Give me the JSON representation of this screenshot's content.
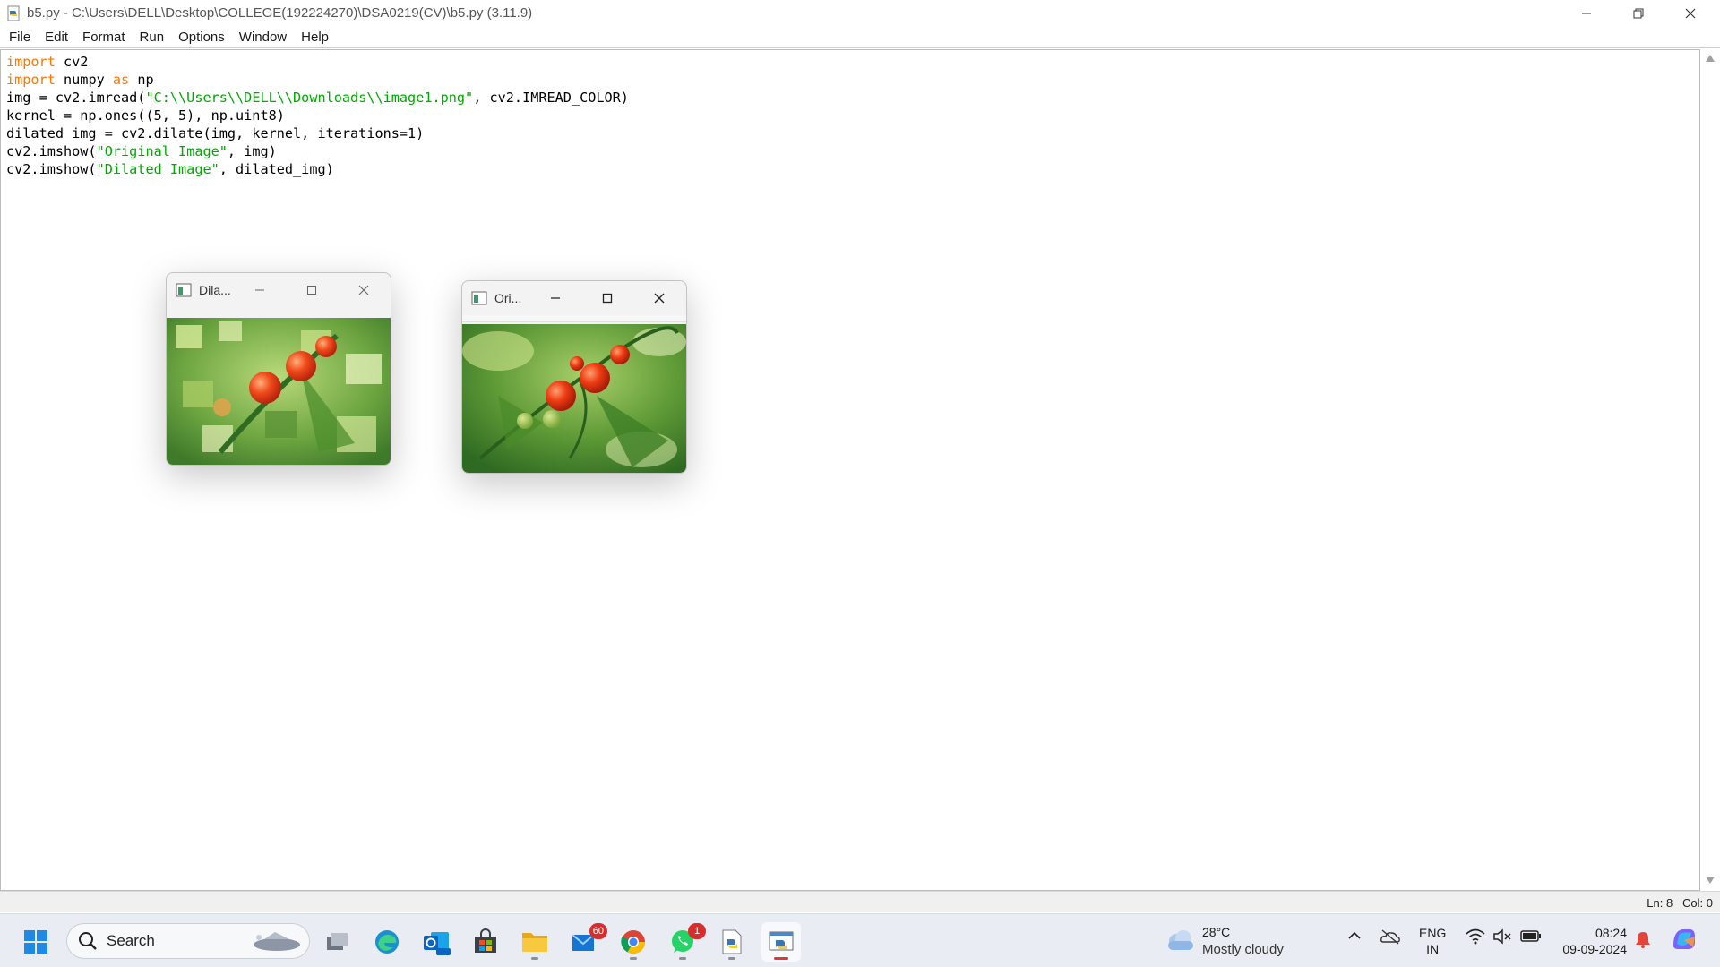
{
  "window": {
    "title": "b5.py - C:\\Users\\DELL\\Desktop\\COLLEGE(192224270)\\DSA0219(CV)\\b5.py (3.11.9)"
  },
  "menu": [
    "File",
    "Edit",
    "Format",
    "Run",
    "Options",
    "Window",
    "Help"
  ],
  "code": [
    [
      "kw:import",
      " cv2"
    ],
    [
      "kw:import",
      " numpy ",
      "kw:as",
      " np"
    ],
    [
      "img = cv2.imread(",
      "str:\"C:\\\\Users\\\\DELL\\\\Downloads\\\\image1.png\"",
      ", cv2.IMREAD_COLOR)"
    ],
    [
      "kernel = np.ones((5, 5), np.uint8)"
    ],
    [
      "dilated_img = cv2.dilate(img, kernel, iterations=1)"
    ],
    [
      "cv2.imshow(",
      "str:\"Original Image\"",
      ", img)"
    ],
    [
      "cv2.imshow(",
      "str:\"Dilated Image\"",
      ", dilated_img)"
    ]
  ],
  "statusbar": {
    "position": "Ln: 8   Col: 0"
  },
  "cv_windows": {
    "dilated": {
      "title": "Dila..."
    },
    "original": {
      "title": "Ori..."
    }
  },
  "taskbar": {
    "search_label": "Search",
    "badges": {
      "mail": "60",
      "whatsapp": "1"
    },
    "weather": {
      "temp": "28°C",
      "condition": "Mostly cloudy"
    },
    "language": {
      "line1": "ENG",
      "line2": "IN"
    },
    "clock": {
      "time": "08:24",
      "date": "09-09-2024"
    }
  },
  "colors": {
    "keyword": "#ff7700",
    "string": "#00aa00",
    "taskbar_bg": "#e9edf3",
    "badge": "#d92c2c"
  }
}
